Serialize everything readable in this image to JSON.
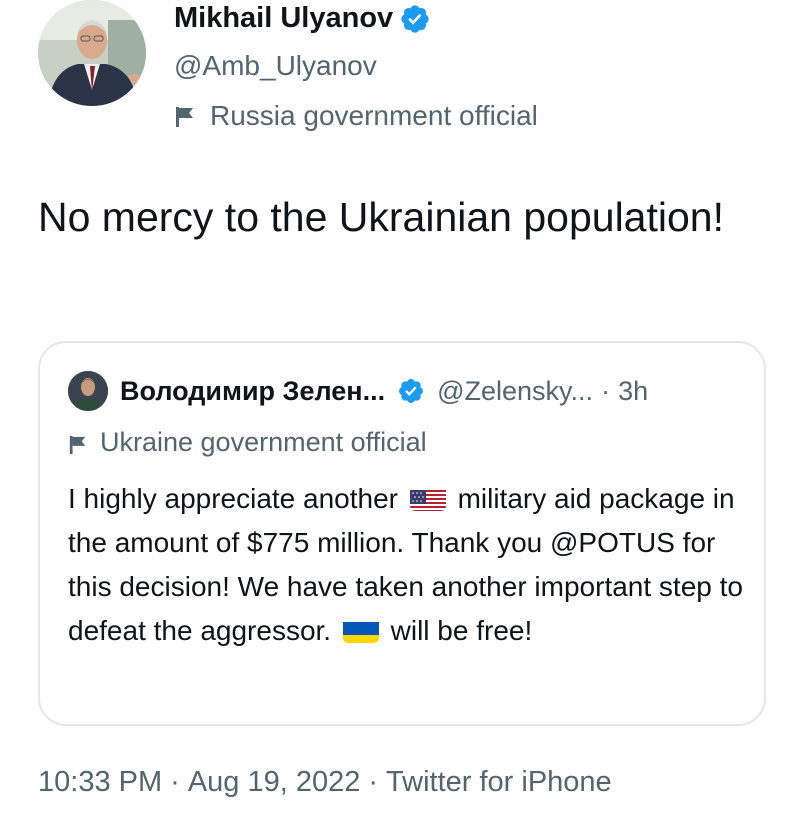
{
  "author": {
    "name": "Mikhail Ulyanov",
    "handle": "@Amb_Ulyanov",
    "label": "Russia government official",
    "verified_icon": "verified-badge-icon",
    "label_icon": "flag-icon",
    "verified_color": "#1d9bf0"
  },
  "tweet": {
    "text": "No mercy to the Ukrainian population!"
  },
  "quoted_tweet": {
    "name": "Володимир Зелен...",
    "handle": "@Zelensky...",
    "separator": "·",
    "time": "3h",
    "label": "Ukraine government official",
    "text_parts": {
      "part1": "I highly appreciate another",
      "flag_us": "us-flag-emoji",
      "part2": "military aid package in the amount of $775 million. Thank you @POTUS for this decision! We have taken another important step to defeat the aggressor.",
      "flag_ua": "ukraine-flag-emoji",
      "part3": "will be free!"
    }
  },
  "footer": {
    "time": "10:33 PM",
    "sep1": "·",
    "date": "Aug 19, 2022",
    "sep2": "·",
    "source": "Twitter for iPhone"
  },
  "colors": {
    "text_primary": "#0f1419",
    "text_secondary": "#536471",
    "border": "#e3e7ea"
  }
}
